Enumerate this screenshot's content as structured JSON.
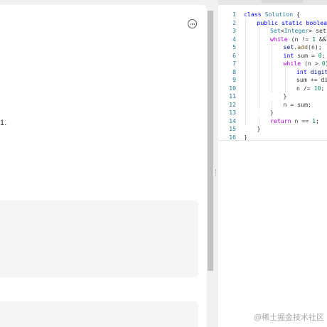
{
  "problem_panel": {
    "desc_fragment": "1."
  },
  "editor": {
    "lines": [
      {
        "n": "1",
        "indent": 0,
        "parts": [
          {
            "t": "class ",
            "c": "kw"
          },
          {
            "t": "Solution ",
            "c": "ty"
          },
          {
            "t": "{",
            "c": ""
          }
        ]
      },
      {
        "n": "2",
        "indent": 1,
        "parts": [
          {
            "t": "public static boolean ",
            "c": "kw"
          }
        ]
      },
      {
        "n": "3",
        "indent": 2,
        "parts": [
          {
            "t": "Set",
            "c": "ty"
          },
          {
            "t": "<",
            "c": ""
          },
          {
            "t": "Integer",
            "c": "ty"
          },
          {
            "t": "> set = ",
            "c": ""
          }
        ]
      },
      {
        "n": "4",
        "indent": 2,
        "parts": [
          {
            "t": "while ",
            "c": "kw2"
          },
          {
            "t": "(n != ",
            "c": ""
          },
          {
            "t": "1",
            "c": "num"
          },
          {
            "t": " && !",
            "c": ""
          }
        ]
      },
      {
        "n": "5",
        "indent": 3,
        "parts": [
          {
            "t": "set",
            "c": "var"
          },
          {
            "t": ".",
            "c": ""
          },
          {
            "t": "add",
            "c": "fn"
          },
          {
            "t": "(n);",
            "c": ""
          }
        ]
      },
      {
        "n": "6",
        "indent": 3,
        "parts": [
          {
            "t": "int ",
            "c": "kw"
          },
          {
            "t": "sum = ",
            "c": ""
          },
          {
            "t": "0",
            "c": "num"
          },
          {
            "t": ";",
            "c": ""
          }
        ]
      },
      {
        "n": "7",
        "indent": 3,
        "parts": [
          {
            "t": "while ",
            "c": "kw2"
          },
          {
            "t": "(n > ",
            "c": ""
          },
          {
            "t": "0",
            "c": "num"
          },
          {
            "t": ")",
            "c": ""
          }
        ]
      },
      {
        "n": "8",
        "indent": 4,
        "parts": [
          {
            "t": "int ",
            "c": "kw"
          },
          {
            "t": "digit",
            "c": "var"
          }
        ]
      },
      {
        "n": "9",
        "indent": 4,
        "parts": [
          {
            "t": "sum += dig",
            "c": ""
          }
        ]
      },
      {
        "n": "10",
        "indent": 4,
        "parts": [
          {
            "t": "n /= ",
            "c": ""
          },
          {
            "t": "10",
            "c": "num"
          },
          {
            "t": ";",
            "c": ""
          }
        ]
      },
      {
        "n": "11",
        "indent": 3,
        "parts": [
          {
            "t": "}",
            "c": ""
          }
        ]
      },
      {
        "n": "12",
        "indent": 3,
        "parts": [
          {
            "t": "n = sum;",
            "c": ""
          }
        ]
      },
      {
        "n": "13",
        "indent": 2,
        "parts": [
          {
            "t": "}",
            "c": ""
          }
        ]
      },
      {
        "n": "14",
        "indent": 2,
        "parts": [
          {
            "t": "return ",
            "c": "kw2"
          },
          {
            "t": "n == ",
            "c": ""
          },
          {
            "t": "1",
            "c": "num"
          },
          {
            "t": ";",
            "c": ""
          }
        ]
      },
      {
        "n": "15",
        "indent": 1,
        "parts": [
          {
            "t": "}",
            "c": ""
          }
        ]
      },
      {
        "n": "16",
        "indent": 0,
        "parts": [
          {
            "t": "}",
            "c": ""
          }
        ]
      }
    ]
  },
  "watermark": "@稀土掘金技术社区",
  "colors": {
    "keyword": "#0000ff",
    "control": "#af00db",
    "type": "#267f99",
    "number": "#098658",
    "line_number": "#237893"
  },
  "icons": {
    "more": "more-horizontal-icon"
  }
}
